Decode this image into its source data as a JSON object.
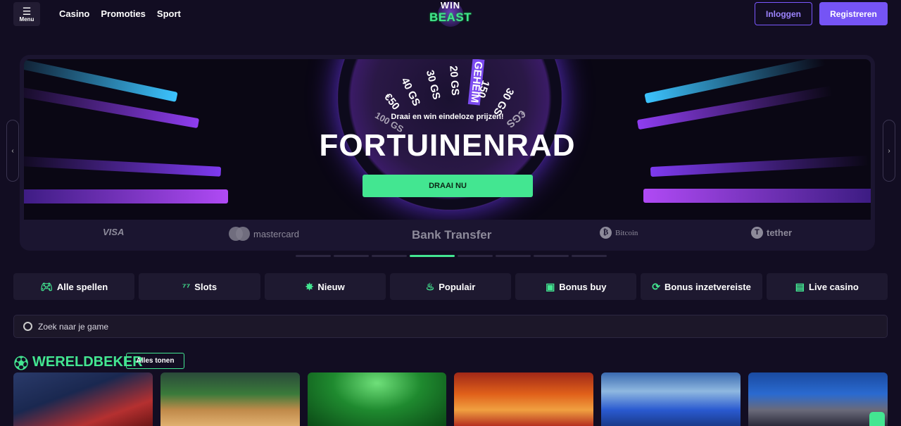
{
  "header": {
    "menu_label": "Menu",
    "nav": [
      "Casino",
      "Promoties",
      "Sport"
    ],
    "logo_line1": "WIN",
    "logo_line2": "BEAST",
    "login_label": "Inloggen",
    "register_label": "Registreren"
  },
  "banner": {
    "wheel_segments": [
      "€50",
      "40 GS",
      "30 GS",
      "20 GS",
      "GEHEIM",
      "150",
      "30 GS",
      "€GS",
      "100 GS"
    ],
    "subtitle": "Draai en win eindeloze prijzen!",
    "title": "FORTUINENRAD",
    "cta_label": "DRAAI NU"
  },
  "payments": [
    "VISA",
    "mastercard",
    "Bank Transfer",
    "Bitcoin",
    "tether"
  ],
  "carousel": {
    "total_slides": 8,
    "active_index": 3
  },
  "categories": [
    {
      "label": "Alle spellen",
      "icon": "gamepad-icon"
    },
    {
      "label": "Slots",
      "icon": "slots-icon"
    },
    {
      "label": "Nieuw",
      "icon": "new-badge-icon"
    },
    {
      "label": "Populair",
      "icon": "flame-icon"
    },
    {
      "label": "Bonus buy",
      "icon": "gift-icon"
    },
    {
      "label": "Bonus inzetvereiste",
      "icon": "coin-cycle-icon"
    },
    {
      "label": "Live casino",
      "icon": "live-icon"
    }
  ],
  "search": {
    "placeholder": "Zoek naar je game"
  },
  "section": {
    "title": "WERELDBEKER",
    "show_all_label": "Alles tonen"
  },
  "colors": {
    "accent_green": "#43e691",
    "accent_purple": "#7554f5",
    "background": "#120d22"
  }
}
